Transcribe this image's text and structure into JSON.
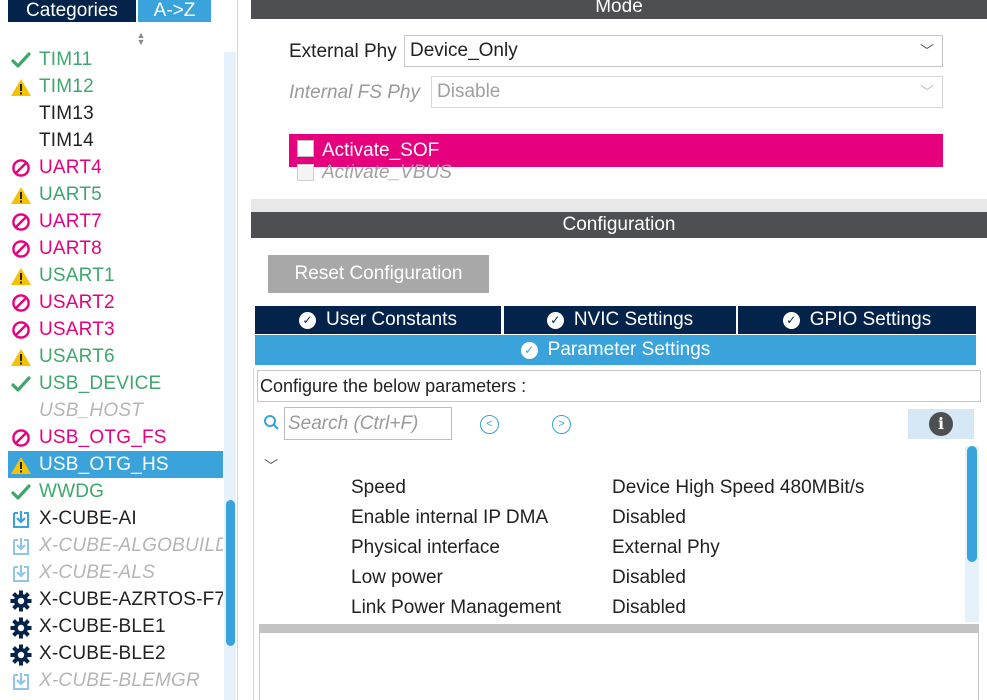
{
  "left": {
    "tabs": {
      "categories": "Categories",
      "az": "A->Z"
    },
    "items": [
      {
        "label": "TIM11",
        "status": "ok",
        "color": "green"
      },
      {
        "label": "TIM12",
        "status": "warning",
        "color": "green"
      },
      {
        "label": "TIM13",
        "status": "none",
        "color": "black"
      },
      {
        "label": "TIM14",
        "status": "none",
        "color": "black"
      },
      {
        "label": "UART4",
        "status": "disabled",
        "color": "pink"
      },
      {
        "label": "UART5",
        "status": "warning",
        "color": "green"
      },
      {
        "label": "UART7",
        "status": "disabled",
        "color": "pink"
      },
      {
        "label": "UART8",
        "status": "disabled",
        "color": "pink"
      },
      {
        "label": "USART1",
        "status": "warning",
        "color": "green"
      },
      {
        "label": "USART2",
        "status": "disabled",
        "color": "pink"
      },
      {
        "label": "USART3",
        "status": "disabled",
        "color": "pink"
      },
      {
        "label": "USART6",
        "status": "warning",
        "color": "green"
      },
      {
        "label": "USB_DEVICE",
        "status": "ok",
        "color": "green"
      },
      {
        "label": "USB_HOST",
        "status": "none",
        "color": "gray"
      },
      {
        "label": "USB_OTG_FS",
        "status": "disabled",
        "color": "pink"
      },
      {
        "label": "USB_OTG_HS",
        "status": "warning",
        "color": "selected",
        "selected": true
      },
      {
        "label": "WWDG",
        "status": "ok",
        "color": "green"
      },
      {
        "label": "X-CUBE-AI",
        "status": "pack",
        "color": "black"
      },
      {
        "label": "X-CUBE-ALGOBUILD",
        "status": "pack-gray",
        "color": "gray"
      },
      {
        "label": "X-CUBE-ALS",
        "status": "pack-gray",
        "color": "gray"
      },
      {
        "label": "X-CUBE-AZRTOS-F7",
        "status": "gear",
        "color": "black"
      },
      {
        "label": "X-CUBE-BLE1",
        "status": "gear",
        "color": "black"
      },
      {
        "label": "X-CUBE-BLE2",
        "status": "gear",
        "color": "black"
      },
      {
        "label": "X-CUBE-BLEMGR",
        "status": "pack-gray",
        "color": "gray"
      }
    ]
  },
  "mode": {
    "header": "Mode",
    "external_phy_label": "External Phy",
    "external_phy_value": "Device_Only",
    "internal_fs_phy_label": "Internal FS Phy",
    "internal_fs_phy_value": "Disable",
    "activate_sof_label": "Activate_SOF",
    "activate_vbus_label": "Activate_VBUS"
  },
  "config": {
    "header": "Configuration",
    "reset_button": "Reset Configuration",
    "tabs": [
      "User Constants",
      "NVIC Settings",
      "GPIO Settings"
    ],
    "active_tab": "Parameter Settings",
    "description": "Configure the below parameters :",
    "search_placeholder": "Search (Ctrl+F)",
    "params": [
      {
        "key": "Speed",
        "value": "Device High Speed 480MBit/s"
      },
      {
        "key": "Enable internal IP DMA",
        "value": "Disabled"
      },
      {
        "key": "Physical interface",
        "value": "External Phy"
      },
      {
        "key": "Low power",
        "value": "Disabled"
      },
      {
        "key": "Link Power Management",
        "value": "Disabled"
      }
    ]
  },
  "colors": {
    "navy": "#03234b",
    "blue": "#3aa3dc",
    "pink": "#e6007e",
    "green": "#3fa66c",
    "warning": "#f6c200",
    "header_gray": "#4d4f53"
  }
}
